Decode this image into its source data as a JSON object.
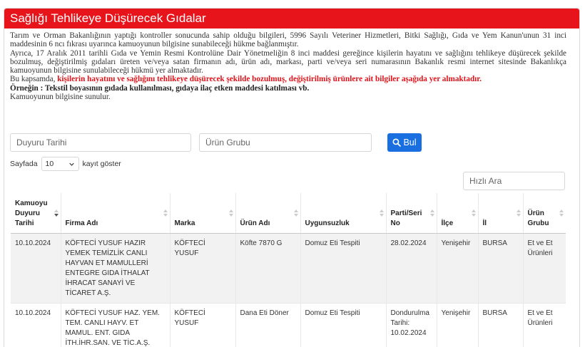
{
  "panel": {
    "title": "Sağlığı Tehlikeye Düşürecek Gıdalar",
    "header_color": "#e8141b"
  },
  "intro": {
    "p1": "Tarım ve Orman Bakanlığının yaptığı kontroller sonucunda sahip olduğu bilgileri, 5996 Sayılı Veteriner Hizmetleri, Bitki Sağlığı, Gıda ve Yem Kanun'unun 31 inci maddesinin 6 ncı fıkrası uyarınca kamuoyunun bilgisine sunabileceği hükme bağlanmıştır.",
    "p2": "Ayrıca, 17 Aralık 2011 tarihli Gıda ve Yemin Resmi Kontrolüne Dair Yönetmeliğin 8 inci maddesi gereğince kişilerin hayatını ve sağlığını tehlikeye düşürecek şekilde bozulmuş, değiştirilmiş gıdaları üreten ve/veya satan firmanın adı, ürün adı, markası, parti ve/veya seri numarasının Bakanlık resmi internet sitesinde Bakanlıkça kamuoyunun bilgisine sunulabileceği hükmü yer almaktadır.",
    "p3_prefix": "Bu kapsamda, ",
    "p3_red": "kişilerin hayatını ve sağlığını tehlikeye düşürecek şekilde bozulmuş, değiştirilmiş ürünlere ait bilgiler aşağıda yer almaktadır.",
    "p4": "Örneğin : Tekstil boyasının gıdada kullanılması, gıdaya ilaç etken maddesi katılması vb.",
    "p5": "Kamuoyunun bilgisine sunulur."
  },
  "filters": {
    "date_placeholder": "Duyuru Tarihi",
    "group_placeholder": "Ürün Grubu",
    "search_label": "Bul",
    "button_color": "#1a6fe0"
  },
  "length": {
    "prefix": "Sayfada",
    "value": "10",
    "suffix": "kayıt göster"
  },
  "quick_search": {
    "placeholder": "Hızlı Ara"
  },
  "table": {
    "headers": [
      "Kamuoyu Duyuru Tarihi",
      "Firma Adı",
      "Marka",
      "Ürün Adı",
      "Uygunsuzluk",
      "Parti/Seri No",
      "İlçe",
      "İl",
      "Ürün Grubu"
    ],
    "rows": [
      [
        "10.10.2024",
        "KÖFTECİ YUSUF HAZIR YEMEK TEMİZLİK CANLI HAYVAN ET MAMULLERİ ENTEGRE GIDA İTHALAT İHRACAT SANAYİ VE TİCARET A.Ş.",
        "KÖFTECİ YUSUF",
        "Köfte 7870 G",
        "Domuz Eti Tespiti",
        "28.02.2024",
        "Yenişehir",
        "BURSA",
        "Et ve Et Ürünleri"
      ],
      [
        "10.10.2024",
        "KÖFTECİ YUSUF HAZ. YEM. TEM. CANLI HAYV. ET MAMUL. ENT. GIDA İTH.İHR.SAN. VE TİC.A.Ş. (ÜRETİM YERİ)",
        "KÖFTECİ YUSUF",
        "Dana Eti Döner",
        "Domuz Eti Tespiti",
        "Dondurulma Tarihi: 10.02.2024",
        "Yenişehir",
        "BURSA",
        "Et ve Et Ürünleri"
      ]
    ]
  }
}
